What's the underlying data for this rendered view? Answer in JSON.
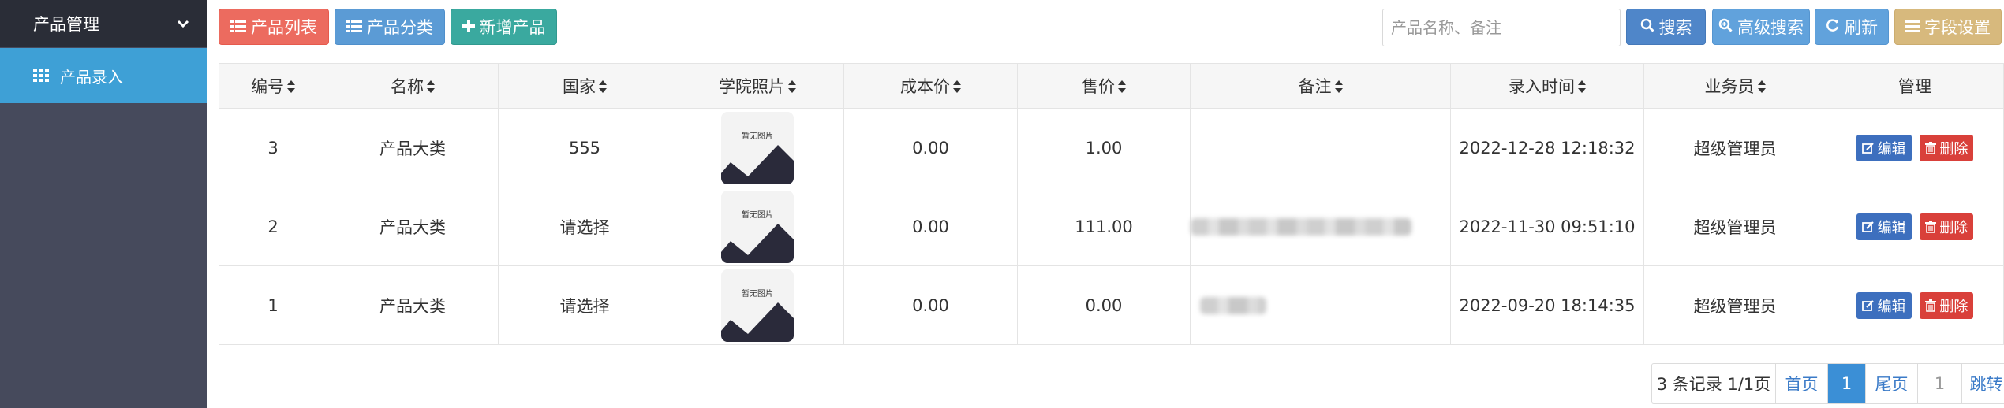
{
  "sidebar": {
    "section_title": "产品管理",
    "items": [
      {
        "label": "产品录入",
        "icon": "grid-icon",
        "active": true
      }
    ]
  },
  "toolbar": {
    "list_label": "产品列表",
    "category_label": "产品分类",
    "add_label": "新增产品",
    "search_placeholder": "产品名称、备注",
    "search_label": "搜索",
    "advanced_label": "高级搜索",
    "refresh_label": "刷新",
    "fields_label": "字段设置"
  },
  "table": {
    "headers": {
      "id": "编号",
      "name": "名称",
      "country": "国家",
      "photo": "学院照片",
      "cost": "成本价",
      "price": "售价",
      "note": "备注",
      "created": "录入时间",
      "staff": "业务员",
      "manage": "管理"
    },
    "rows": [
      {
        "id": "3",
        "name": "产品大类",
        "country": "555",
        "photo_text": "暂无图片",
        "cost": "0.00",
        "price": "1.00",
        "note": "",
        "created": "2022-12-28 12:18:32",
        "staff": "超级管理员"
      },
      {
        "id": "2",
        "name": "产品大类",
        "country": "请选择",
        "photo_text": "暂无图片",
        "cost": "0.00",
        "price": "111.00",
        "note": "",
        "created": "2022-11-30 09:51:10",
        "staff": "超级管理员"
      },
      {
        "id": "1",
        "name": "产品大类",
        "country": "请选择",
        "photo_text": "暂无图片",
        "cost": "0.00",
        "price": "0.00",
        "note": "",
        "created": "2022-09-20 18:14:35",
        "staff": "超级管理员"
      }
    ],
    "edit_label": "编辑",
    "delete_label": "删除"
  },
  "pagination": {
    "info": "3 条记录 1/1页",
    "first": "首页",
    "current": "1",
    "last": "尾页",
    "page_input": "1",
    "jump": "跳转"
  },
  "colors": {
    "sidebar_bg": "#464a5c",
    "sidebar_header": "#2a2d37",
    "sidebar_active": "#3ea0d6",
    "btn_red": "#ec6b5f",
    "btn_blue": "#5b9bd5",
    "btn_teal": "#3aa99f",
    "btn_gold": "#d7b97d",
    "edit": "#3d6fbe",
    "delete": "#d9403a"
  }
}
